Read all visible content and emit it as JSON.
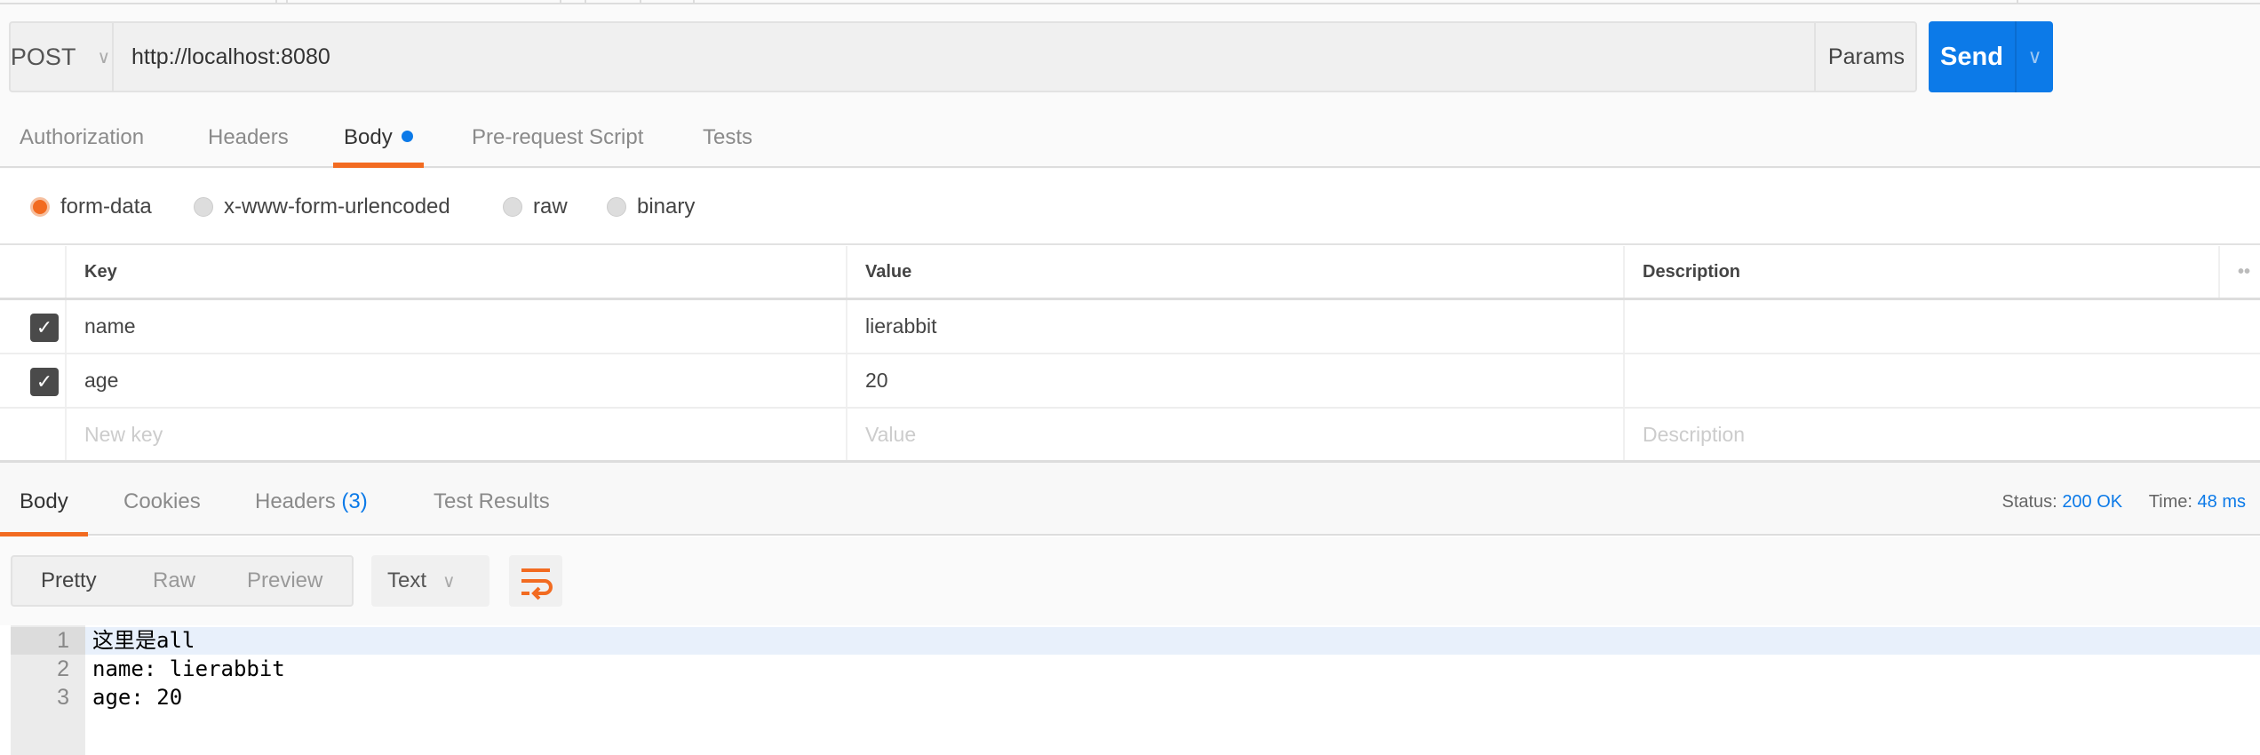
{
  "request": {
    "method": "POST",
    "url": "http://localhost:8080",
    "params_label": "Params",
    "send_label": "Send"
  },
  "request_tabs": [
    {
      "label": "Authorization"
    },
    {
      "label": "Headers"
    },
    {
      "label": "Body",
      "active": true
    },
    {
      "label": "Pre-request Script"
    },
    {
      "label": "Tests"
    }
  ],
  "body_modes": [
    {
      "label": "form-data",
      "selected": true
    },
    {
      "label": "x-www-form-urlencoded"
    },
    {
      "label": "raw"
    },
    {
      "label": "binary"
    }
  ],
  "table": {
    "headers": {
      "key": "Key",
      "value": "Value",
      "description": "Description"
    },
    "rows": [
      {
        "checked": true,
        "key": "name",
        "value": "lierabbit",
        "description": ""
      },
      {
        "checked": true,
        "key": "age",
        "value": "20",
        "description": ""
      }
    ],
    "placeholders": {
      "key": "New key",
      "value": "Value",
      "description": "Description"
    }
  },
  "response_tabs": {
    "body": "Body",
    "cookies": "Cookies",
    "headers": "Headers",
    "headers_count": "(3)",
    "tests": "Test Results"
  },
  "status": {
    "status_label": "Status:",
    "status_value": "200 OK",
    "time_label": "Time:",
    "time_value": "48 ms"
  },
  "view": {
    "pretty": "Pretty",
    "raw": "Raw",
    "preview": "Preview",
    "format": "Text"
  },
  "response_lines": [
    {
      "n": "1",
      "text": "这里是all"
    },
    {
      "n": "2",
      "text": "name: lierabbit"
    },
    {
      "n": "3",
      "text": "age: 20"
    }
  ],
  "colors": {
    "accent": "#f26b21",
    "primary": "#0c7ae8"
  }
}
